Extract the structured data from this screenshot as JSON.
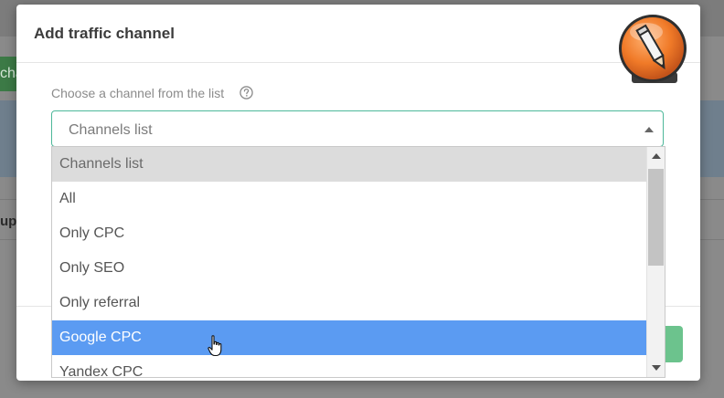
{
  "background": {
    "left_button_fragment": "cha",
    "left_text_fragment": "up"
  },
  "modal": {
    "title": "Add traffic channel",
    "logo_icon": "pencil-logo-icon"
  },
  "field": {
    "label": "Choose a channel from the list",
    "help_icon": "question-circle-icon",
    "select": {
      "value": "Channels list"
    }
  },
  "dropdown": {
    "items": [
      {
        "label": "Channels list",
        "state": "header"
      },
      {
        "label": "All",
        "state": "normal"
      },
      {
        "label": "Only CPC",
        "state": "normal"
      },
      {
        "label": "Only SEO",
        "state": "normal"
      },
      {
        "label": "Only referral",
        "state": "normal"
      },
      {
        "label": "Google CPC",
        "state": "highlighted"
      },
      {
        "label": "Yandex CPC",
        "state": "normal"
      }
    ]
  },
  "colors": {
    "accent": "#4db89a",
    "highlight": "#5b9bf2",
    "logo_orange": "#f07a28"
  }
}
